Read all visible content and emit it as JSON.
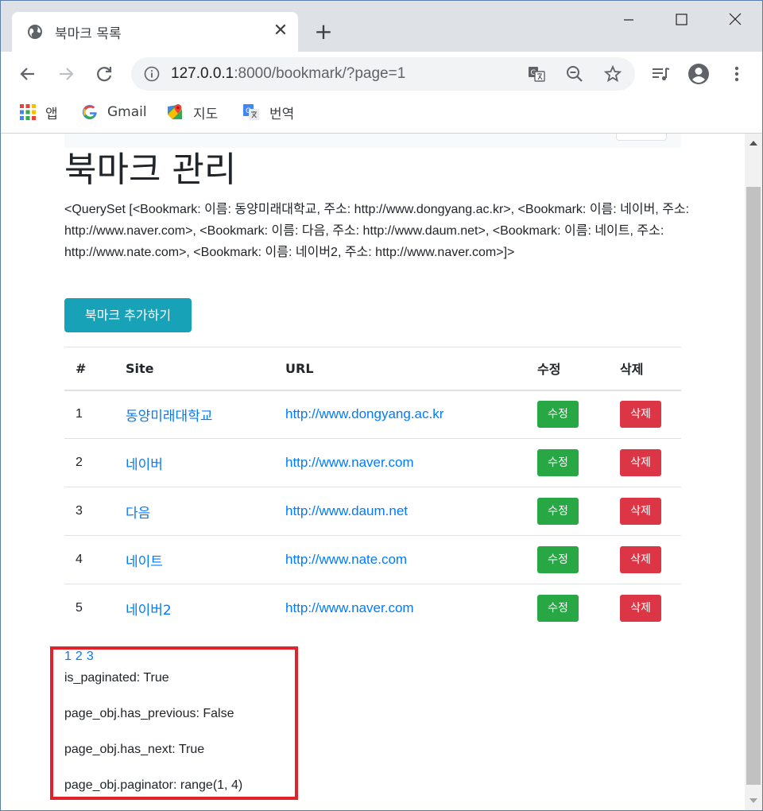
{
  "browser": {
    "tab_title": "북마크 목록",
    "url_host": "127.0.0.1",
    "url_rest": ":8000/bookmark/?page=1",
    "bookmarks": [
      {
        "label": "앱",
        "icon": "apps-grid-icon"
      },
      {
        "label": "Gmail",
        "icon": "google-icon"
      },
      {
        "label": "지도",
        "icon": "maps-icon"
      },
      {
        "label": "번역",
        "icon": "translate-icon"
      }
    ]
  },
  "page": {
    "title": "북마크 관리",
    "queryset_text": "<QuerySet [<Bookmark: 이름: 동양미래대학교, 주소: http://www.dongyang.ac.kr>, <Bookmark: 이름: 네이버, 주소: http://www.naver.com>, <Bookmark: 이름: 다음, 주소: http://www.daum.net>, <Bookmark: 이름: 네이트, 주소: http://www.nate.com>, <Bookmark: 이름: 네이버2, 주소: http://www.naver.com>]>",
    "add_button": "북마크 추가하기",
    "table": {
      "headers": [
        "#",
        "Site",
        "URL",
        "수정",
        "삭제"
      ],
      "rows": [
        {
          "num": "1",
          "site": "동양미래대학교",
          "url": "http://www.dongyang.ac.kr",
          "edit": "수정",
          "delete": "삭제"
        },
        {
          "num": "2",
          "site": "네이버",
          "url": "http://www.naver.com",
          "edit": "수정",
          "delete": "삭제"
        },
        {
          "num": "3",
          "site": "다음",
          "url": "http://www.daum.net",
          "edit": "수정",
          "delete": "삭제"
        },
        {
          "num": "4",
          "site": "네이트",
          "url": "http://www.nate.com",
          "edit": "수정",
          "delete": "삭제"
        },
        {
          "num": "5",
          "site": "네이버2",
          "url": "http://www.naver.com",
          "edit": "수정",
          "delete": "삭제"
        }
      ]
    },
    "pages": [
      "1",
      "2",
      "3"
    ],
    "info": [
      "is_paginated: True",
      "page_obj.has_previous: False",
      "page_obj.has_next: True",
      "page_obj.paginator: range(1, 4)"
    ]
  },
  "colors": {
    "primary_link": "#007bff",
    "info_button": "#17a2b8",
    "success_button": "#28a745",
    "danger_button": "#dc3545",
    "highlight_border": "#e0232a"
  }
}
